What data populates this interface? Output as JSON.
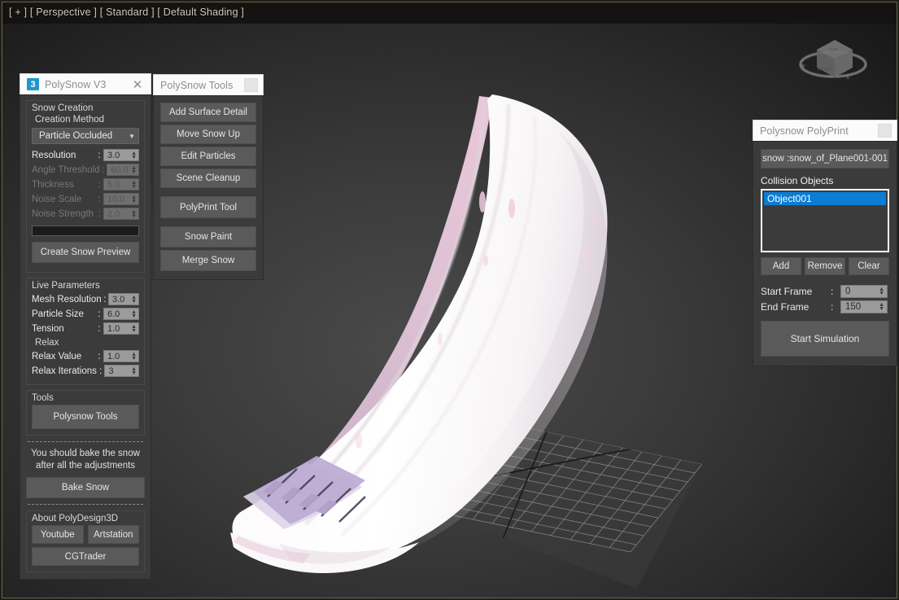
{
  "viewport": {
    "label": "[ + ] [ Perspective ] [ Standard ] [ Default Shading ]",
    "viewcube_name": "view-cube",
    "axis_tripod_name": "axis-tripod"
  },
  "polysnow_panel": {
    "title": "PolySnow V3",
    "icon_badge": "3",
    "close_label": "✕",
    "snow_creation": {
      "group_title": "Snow Creation",
      "sub_label": "Creation Method",
      "method_value": "Particle Occluded",
      "params": [
        {
          "name": "Resolution",
          "colon": ":",
          "value": "3.0",
          "enabled": true
        },
        {
          "name": "Angle Threshold",
          "colon": ":",
          "value": "60.0",
          "enabled": false
        },
        {
          "name": "Thickness",
          "colon": ":",
          "value": "5.0",
          "enabled": false
        },
        {
          "name": "Noise Scale",
          "colon": ":",
          "value": "10.0",
          "enabled": false
        },
        {
          "name": "Noise Strength",
          "colon": ":",
          "value": "2.0",
          "enabled": false
        }
      ],
      "create_button": "Create Snow Preview"
    },
    "live_parameters": {
      "group_title": "Live Parameters",
      "params": [
        {
          "name": "Mesh Resolution",
          "colon": ":",
          "value": "3.0"
        },
        {
          "name": "Particle Size",
          "colon": ":",
          "value": "6.0"
        },
        {
          "name": "Tension",
          "colon": ":",
          "value": "1.0"
        }
      ],
      "relax_label": "Relax",
      "relax_params": [
        {
          "name": "Relax Value",
          "colon": ":",
          "value": "1.0"
        },
        {
          "name": "Relax Iterations",
          "colon": ":",
          "value": "3"
        }
      ]
    },
    "tools": {
      "group_title": "Tools",
      "button": "Polysnow Tools"
    },
    "bake": {
      "note_line1": "You should bake the snow",
      "note_line2": "after all the adjustments",
      "button": "Bake Snow"
    },
    "about": {
      "group_title": "About PolyDesign3D",
      "youtube": "Youtube",
      "artstation": "Artstation",
      "cgtrader": "CGTrader"
    }
  },
  "tools_panel": {
    "title": "PolySnow Tools",
    "buttons_group_a": [
      "Add Surface Detail",
      "Move Snow Up",
      "Edit Particles",
      "Scene Cleanup"
    ],
    "buttons_group_b": [
      "PolyPrint Tool"
    ],
    "buttons_group_c": [
      "Snow Paint",
      "Merge Snow"
    ]
  },
  "polyprint_panel": {
    "title": "Polysnow PolyPrint",
    "snow_field": "snow :snow_of_Plane001-001",
    "collision_label": "Collision Objects",
    "collision_items": [
      "Object001"
    ],
    "list_buttons": [
      "Add",
      "Remove",
      "Clear"
    ],
    "frames": [
      {
        "name": "Start Frame",
        "colon": ":",
        "value": "0"
      },
      {
        "name": "End Frame",
        "colon": ":",
        "value": "150"
      }
    ],
    "simulate_button": "Start Simulation"
  },
  "colors": {
    "accent_blue": "#0a7dd4",
    "viewport_border": "#6e6637",
    "panel_bg": "#3b3b3b",
    "button_bg": "#5a5a5a",
    "snow_white": "#fefefe",
    "snow_pink": "#f2d6e0",
    "tread_purple": "#b9a8cf"
  }
}
